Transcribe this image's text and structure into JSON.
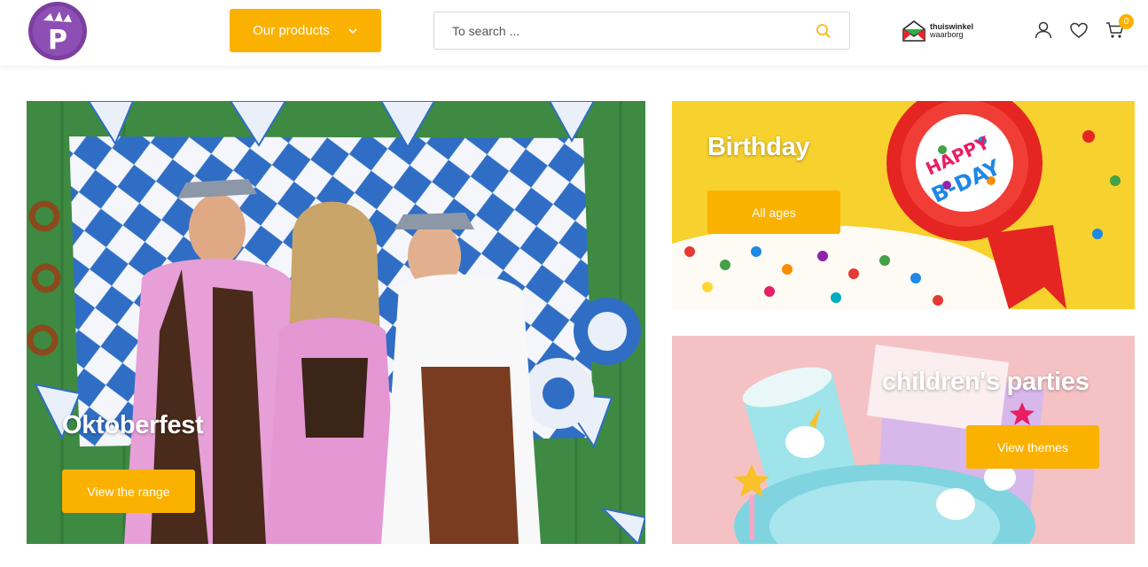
{
  "header": {
    "products_label": "Our products",
    "search_placeholder": "To search ...",
    "trust_badge": {
      "line1": "thuiswinkel",
      "line2": "waarborg"
    },
    "cart_count": "0"
  },
  "tiles": {
    "oktoberfest": {
      "title": "Oktoberfest",
      "button": "View the range"
    },
    "birthday": {
      "title": "Birthday",
      "button": "All ages"
    },
    "children": {
      "title": "children's parties",
      "button": "View themes"
    }
  },
  "colors": {
    "accent": "#fbb100",
    "logo_purple": "#7c3fa0"
  },
  "icons": [
    "chevron-down-icon",
    "search-icon",
    "user-icon",
    "heart-icon",
    "cart-icon"
  ]
}
